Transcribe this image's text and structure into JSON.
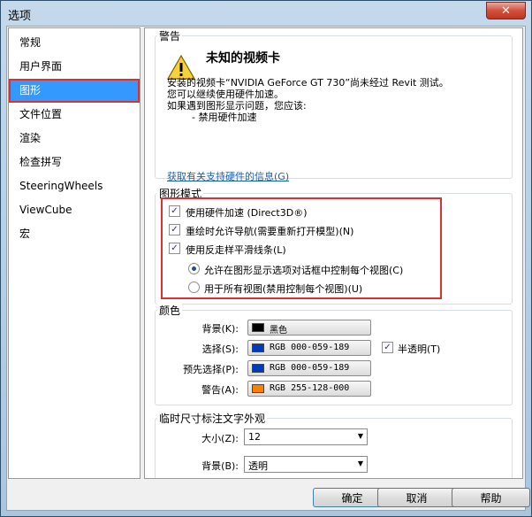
{
  "window": {
    "title": "选项",
    "close_glyph": "✕"
  },
  "sidebar": {
    "items": [
      {
        "label": "常规"
      },
      {
        "label": "用户界面"
      },
      {
        "label": "图形"
      },
      {
        "label": "文件位置"
      },
      {
        "label": "渲染"
      },
      {
        "label": "检查拼写"
      },
      {
        "label": "SteeringWheels"
      },
      {
        "label": "ViewCube"
      },
      {
        "label": "宏"
      }
    ],
    "selected": "图形"
  },
  "warning": {
    "section_title": "警告",
    "heading": "未知的视频卡",
    "lines": [
      "安装的视频卡“NVIDIA GeForce GT 730”尚未经过 Revit 测试。",
      "您可以继续使用硬件加速。",
      "如果遇到图形显示问题，您应该:",
      "        - 禁用硬件加速"
    ],
    "link": "获取有关支持硬件的信息(G)",
    "icon": "warning-icon"
  },
  "graphics_mode": {
    "section_title": "图形模式",
    "options": [
      {
        "label": "使用硬件加速 (Direct3D®)",
        "checked": true
      },
      {
        "label": "重绘时允许导航(需要重新打开模型)(N)",
        "checked": true
      },
      {
        "label": "使用反走样平滑线条(L)",
        "checked": true
      }
    ],
    "radios": [
      {
        "label": "允许在图形显示选项对话框中控制每个视图(C)",
        "selected": true
      },
      {
        "label": "用于所有视图(禁用控制每个视图)(U)",
        "selected": false
      }
    ]
  },
  "colors": {
    "section_title": "颜色",
    "rows": [
      {
        "label": "背景(K):",
        "value": "黑色",
        "swatch": "#000000"
      },
      {
        "label": "选择(S):",
        "value": "RGB 000-059-189",
        "swatch": "#003bbd"
      },
      {
        "label": "预先选择(P):",
        "value": "RGB 000-059-189",
        "swatch": "#003bbd"
      },
      {
        "label": "警告(A):",
        "value": "RGB 255-128-000",
        "swatch": "#ff8000"
      }
    ],
    "semi_transparent": {
      "label": "半透明(T)",
      "checked": true
    }
  },
  "temp_dim": {
    "section_title": "临时尺寸标注文字外观",
    "size": {
      "label": "大小(Z):",
      "value": "12"
    },
    "background": {
      "label": "背景(B):",
      "value": "透明"
    }
  },
  "buttons": {
    "ok": "确定",
    "cancel": "取消",
    "help": "帮助"
  }
}
